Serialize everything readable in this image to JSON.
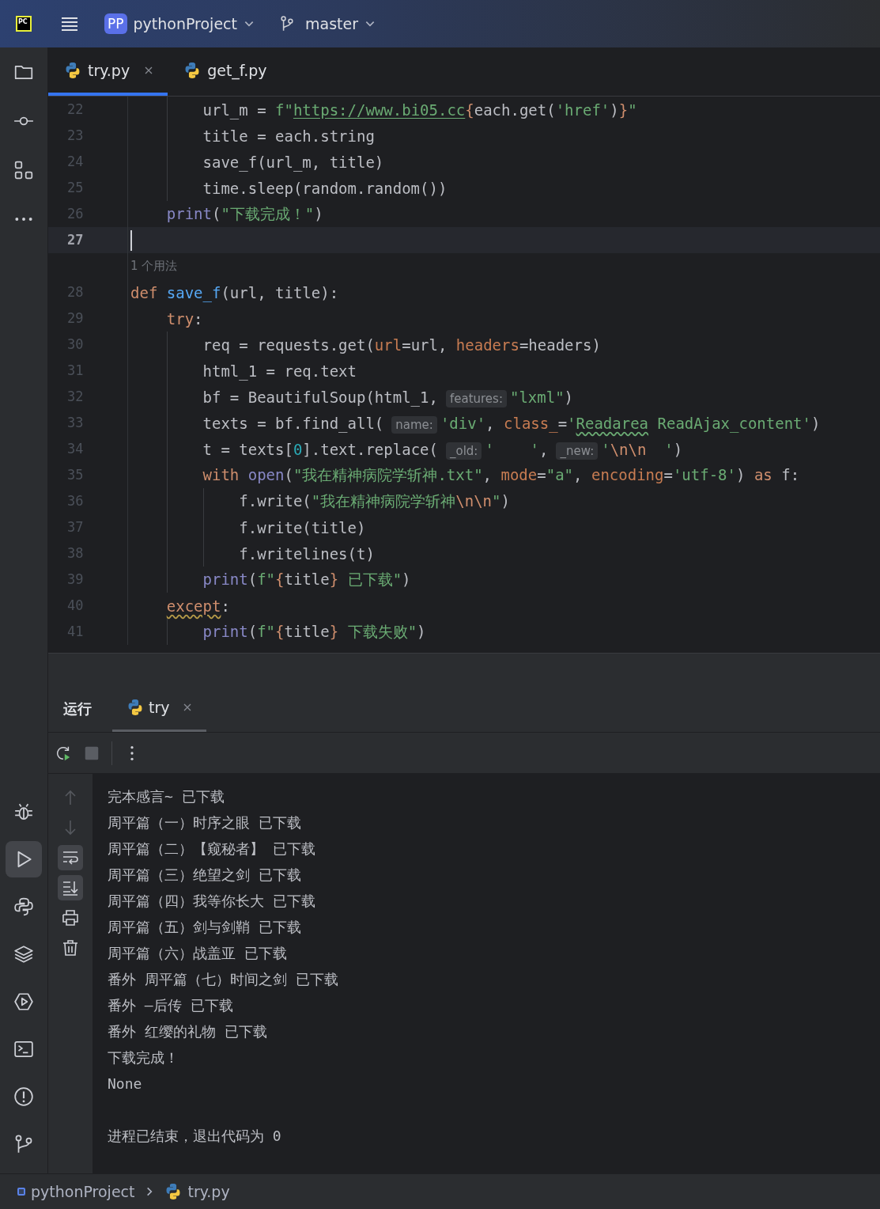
{
  "title_bar": {
    "logo": "PC",
    "project_badge": "PP",
    "project": "pythonProject",
    "branch": "master"
  },
  "sidebar_top": [
    {
      "kind": "project"
    },
    {
      "kind": "commit"
    },
    {
      "kind": "structure"
    },
    {
      "kind": "more"
    }
  ],
  "sidebar_bottom": [
    {
      "kind": "debug",
      "selected": false
    },
    {
      "kind": "run",
      "selected": true
    },
    {
      "kind": "python",
      "selected": false
    },
    {
      "kind": "layers",
      "selected": false
    },
    {
      "kind": "services",
      "selected": false
    },
    {
      "kind": "terminal",
      "selected": false
    },
    {
      "kind": "problems",
      "selected": false
    },
    {
      "kind": "git",
      "selected": false
    }
  ],
  "editor_tabs": [
    {
      "label": "try.py",
      "selected": true,
      "closable": true
    },
    {
      "label": "get_f.py",
      "selected": false,
      "closable": false
    }
  ],
  "code_lines": [
    {
      "kind": "code",
      "number": "22",
      "current": false,
      "tokens": [
        {
          "t": "        url_m = ",
          "kind": "plain"
        },
        {
          "t": "f\"",
          "kind": "str"
        },
        {
          "t": "https://www.bi05.cc",
          "kind": "link"
        },
        {
          "t": "{",
          "kind": "brace"
        },
        {
          "t": "each.get(",
          "kind": "plain"
        },
        {
          "t": "'href'",
          "kind": "str"
        },
        {
          "t": ")",
          "kind": "plain"
        },
        {
          "t": "}",
          "kind": "brace"
        },
        {
          "t": "\"",
          "kind": "str"
        }
      ]
    },
    {
      "kind": "code",
      "number": "23",
      "current": false,
      "tokens": [
        {
          "t": "        title = each.string",
          "kind": "plain"
        }
      ]
    },
    {
      "kind": "code",
      "number": "24",
      "current": false,
      "tokens": [
        {
          "t": "        save_f(url_m, title)",
          "kind": "plain"
        }
      ]
    },
    {
      "kind": "code",
      "number": "25",
      "current": false,
      "tokens": [
        {
          "t": "        time.sleep(random.random())",
          "kind": "plain"
        }
      ]
    },
    {
      "kind": "code",
      "number": "26",
      "current": false,
      "tokens": [
        {
          "t": "    print",
          "kind": "builtin"
        },
        {
          "t": "(",
          "kind": "plain"
        },
        {
          "t": "\"下载完成！\"",
          "kind": "str"
        },
        {
          "t": ")",
          "kind": "plain"
        }
      ]
    },
    {
      "kind": "code",
      "number": "27",
      "current": true
    },
    {
      "kind": "usage",
      "text": "1 个用法"
    },
    {
      "kind": "code",
      "number": "28",
      "current": false,
      "tokens": [
        {
          "t": "def ",
          "kind": "kw"
        },
        {
          "t": "save_f",
          "kind": "defname"
        },
        {
          "t": "(url, title):",
          "kind": "plain"
        }
      ]
    },
    {
      "kind": "code",
      "number": "29",
      "current": false,
      "tokens": [
        {
          "t": "    try",
          "kind": "kw"
        },
        {
          "t": ":",
          "kind": "plain"
        }
      ]
    },
    {
      "kind": "code",
      "number": "30",
      "current": false,
      "tokens": [
        {
          "t": "        req = requests.get(",
          "kind": "plain"
        },
        {
          "t": "url",
          "kind": "param"
        },
        {
          "t": "=url, ",
          "kind": "plain"
        },
        {
          "t": "headers",
          "kind": "param"
        },
        {
          "t": "=headers)",
          "kind": "plain"
        }
      ]
    },
    {
      "kind": "code",
      "number": "31",
      "current": false,
      "tokens": [
        {
          "t": "        html_1 = req.text",
          "kind": "plain"
        }
      ]
    },
    {
      "kind": "code",
      "number": "32",
      "current": false,
      "tokens": [
        {
          "t": "        bf = BeautifulSoup(html_1,",
          "kind": "plain"
        },
        {
          "t": "features:",
          "kind": "hint"
        },
        {
          "t": "\"lxml\"",
          "kind": "str"
        },
        {
          "t": ")",
          "kind": "plain"
        }
      ]
    },
    {
      "kind": "code",
      "number": "33",
      "current": false,
      "tokens": [
        {
          "t": "        texts = bf.find_all(",
          "kind": "plain"
        },
        {
          "t": "name:",
          "kind": "hint"
        },
        {
          "t": "'div'",
          "kind": "str"
        },
        {
          "t": ",",
          "kind": "plain"
        },
        {
          "t": " class_",
          "kind": "param"
        },
        {
          "t": "=",
          "kind": "plain"
        },
        {
          "t": "'",
          "kind": "str"
        },
        {
          "t": "Readarea",
          "kind": "strwarn"
        },
        {
          "t": " ReadAjax_content'",
          "kind": "str"
        },
        {
          "t": ")",
          "kind": "plain"
        }
      ]
    },
    {
      "kind": "code",
      "number": "34",
      "current": false,
      "tokens": [
        {
          "t": "        t = texts[",
          "kind": "plain"
        },
        {
          "t": "0",
          "kind": "num"
        },
        {
          "t": "].text.replace(",
          "kind": "plain"
        },
        {
          "t": "_old:",
          "kind": "hint"
        },
        {
          "t": "'    '",
          "kind": "str"
        },
        {
          "t": ",",
          "kind": "plain"
        },
        {
          "t": "_new:",
          "kind": "hint"
        },
        {
          "t": "'",
          "kind": "str"
        },
        {
          "t": "\\n\\n",
          "kind": "esc"
        },
        {
          "t": "  '",
          "kind": "str"
        },
        {
          "t": ")",
          "kind": "plain"
        }
      ]
    },
    {
      "kind": "code",
      "number": "35",
      "current": false,
      "tokens": [
        {
          "t": "        with ",
          "kind": "kw"
        },
        {
          "t": "open",
          "kind": "builtin"
        },
        {
          "t": "(",
          "kind": "plain"
        },
        {
          "t": "\"我在精神病院学斩神.txt\"",
          "kind": "str"
        },
        {
          "t": ",",
          "kind": "plain"
        },
        {
          "t": " mode",
          "kind": "param"
        },
        {
          "t": "=",
          "kind": "plain"
        },
        {
          "t": "\"a\"",
          "kind": "str"
        },
        {
          "t": ",",
          "kind": "plain"
        },
        {
          "t": " encoding",
          "kind": "param"
        },
        {
          "t": "=",
          "kind": "plain"
        },
        {
          "t": "'utf-8'",
          "kind": "str"
        },
        {
          "t": ")",
          "kind": "plain"
        },
        {
          "t": " as",
          "kind": "kw"
        },
        {
          "t": " f:",
          "kind": "plain"
        }
      ]
    },
    {
      "kind": "code",
      "number": "36",
      "current": false,
      "tokens": [
        {
          "t": "            f.write(",
          "kind": "plain"
        },
        {
          "t": "\"我在精神病院学斩神",
          "kind": "str"
        },
        {
          "t": "\\n\\n",
          "kind": "esc"
        },
        {
          "t": "\"",
          "kind": "str"
        },
        {
          "t": ")",
          "kind": "plain"
        }
      ]
    },
    {
      "kind": "code",
      "number": "37",
      "current": false,
      "tokens": [
        {
          "t": "            f.write(title)",
          "kind": "plain"
        }
      ]
    },
    {
      "kind": "code",
      "number": "38",
      "current": false,
      "tokens": [
        {
          "t": "            f.writelines(t)",
          "kind": "plain"
        }
      ]
    },
    {
      "kind": "code",
      "number": "39",
      "current": false,
      "tokens": [
        {
          "t": "        print",
          "kind": "builtin"
        },
        {
          "t": "(",
          "kind": "plain"
        },
        {
          "t": "f\"",
          "kind": "str"
        },
        {
          "t": "{",
          "kind": "brace"
        },
        {
          "t": "title",
          "kind": "plain"
        },
        {
          "t": "}",
          "kind": "brace"
        },
        {
          "t": " 已下载\"",
          "kind": "str"
        },
        {
          "t": ")",
          "kind": "plain"
        }
      ]
    },
    {
      "kind": "code",
      "number": "40",
      "current": false,
      "tokens": [
        {
          "t": "    except",
          "kind": "kwwarn"
        },
        {
          "t": ":",
          "kind": "plain"
        }
      ]
    },
    {
      "kind": "code",
      "number": "41",
      "current": false,
      "tokens": [
        {
          "t": "        print",
          "kind": "builtin"
        },
        {
          "t": "(",
          "kind": "plain"
        },
        {
          "t": "f\"",
          "kind": "str"
        },
        {
          "t": "{",
          "kind": "brace"
        },
        {
          "t": "title",
          "kind": "plain"
        },
        {
          "t": "}",
          "kind": "brace"
        },
        {
          "t": " 下载失败\"",
          "kind": "str"
        },
        {
          "t": ")",
          "kind": "plain"
        }
      ]
    }
  ],
  "run_panel": {
    "title": "运行",
    "tabs": [
      {
        "label": "try",
        "selected": true
      }
    ],
    "toolbar": [
      {
        "kind": "rerun"
      },
      {
        "kind": "stop"
      },
      {
        "kind": "more"
      }
    ],
    "console_tools": [
      {
        "kind": "up",
        "on": false,
        "disabled": true
      },
      {
        "kind": "down",
        "on": false,
        "disabled": true
      },
      {
        "kind": "wrap",
        "on": true,
        "disabled": false
      },
      {
        "kind": "scroll-end",
        "on": true,
        "disabled": false
      },
      {
        "kind": "print",
        "on": false,
        "disabled": false
      },
      {
        "kind": "clear",
        "on": false,
        "disabled": false
      }
    ],
    "output": [
      {
        "kind": "stdout",
        "text": "完本感言~ 已下载"
      },
      {
        "kind": "stdout",
        "text": "周平篇（一）时序之眼 已下载"
      },
      {
        "kind": "stdout",
        "text": "周平篇（二）【窥秘者】 已下载"
      },
      {
        "kind": "stdout",
        "text": "周平篇（三）绝望之剑 已下载"
      },
      {
        "kind": "stdout",
        "text": "周平篇（四）我等你长大 已下载"
      },
      {
        "kind": "stdout",
        "text": "周平篇（五）剑与剑鞘 已下载"
      },
      {
        "kind": "stdout",
        "text": "周平篇（六）战盖亚 已下载"
      },
      {
        "kind": "stdout",
        "text": "番外 周平篇（七）时间之剑 已下载"
      },
      {
        "kind": "stdout",
        "text": "番外 —后传 已下载"
      },
      {
        "kind": "stdout",
        "text": "番外 红缨的礼物 已下载"
      },
      {
        "kind": "stdout",
        "text": "下载完成！"
      },
      {
        "kind": "stdout",
        "text": "None"
      },
      {
        "kind": "exit",
        "text": "进程已结束，退出代码为 0"
      }
    ]
  },
  "status_bar": {
    "breadcrumbs": [
      {
        "kind": "project",
        "label": "pythonProject"
      },
      {
        "kind": "file",
        "label": "try.py"
      }
    ]
  }
}
